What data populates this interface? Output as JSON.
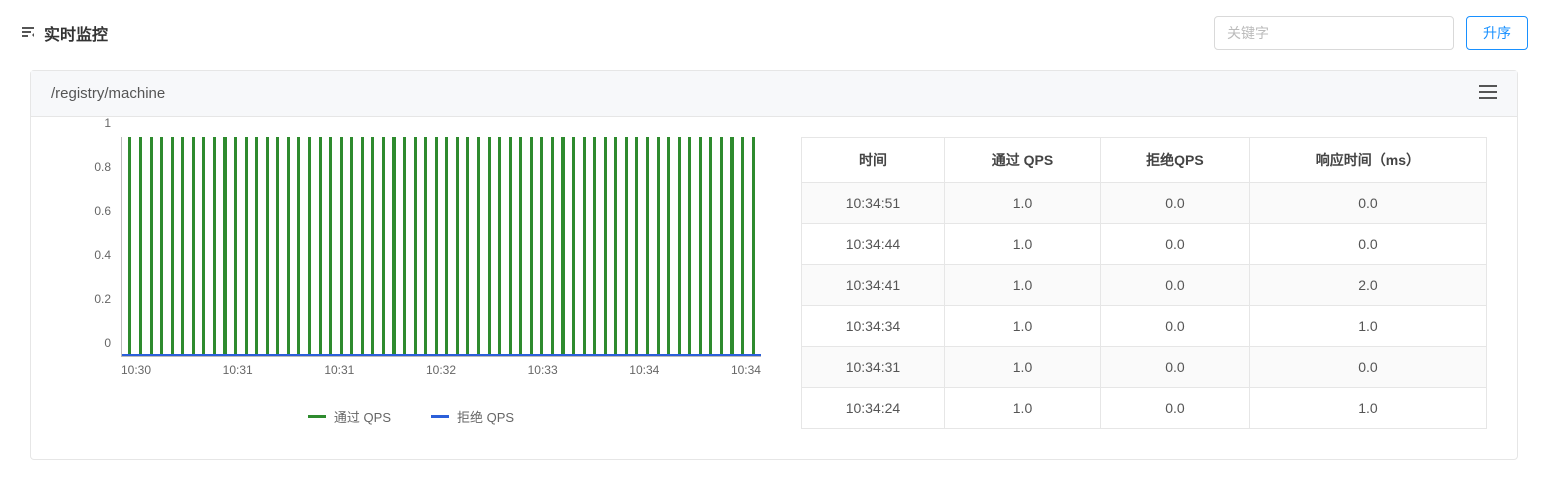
{
  "header": {
    "title": "实时监控",
    "keyword_placeholder": "关键字",
    "sort_button": "升序"
  },
  "panel": {
    "endpoint": "/registry/machine"
  },
  "chart_data": {
    "type": "bar",
    "title": "",
    "legend_position": "bottom",
    "ylim": [
      0,
      1
    ],
    "y_ticks": [
      "0",
      "0.2",
      "0.4",
      "0.6",
      "0.8",
      "1"
    ],
    "x_ticks": [
      "10:30",
      "10:31",
      "10:31",
      "10:32",
      "10:33",
      "10:34",
      "10:34"
    ],
    "series": [
      {
        "name": "通过 QPS",
        "color": "#2e8b2e",
        "values": [
          1,
          1,
          1,
          1,
          1,
          1,
          1,
          1,
          1,
          1,
          1,
          1,
          1,
          1,
          1,
          1,
          1,
          1,
          1,
          1,
          1,
          1,
          1,
          1,
          1,
          1,
          1,
          1,
          1,
          1,
          1,
          1,
          1,
          1,
          1,
          1,
          1,
          1,
          1,
          1,
          1,
          1,
          1,
          1,
          1,
          1,
          1,
          1,
          1,
          1,
          1,
          1,
          1,
          1,
          1,
          1,
          1,
          1,
          1,
          1
        ]
      },
      {
        "name": "拒绝 QPS",
        "color": "#2b5fd9",
        "values": [
          0,
          0,
          0,
          0,
          0,
          0,
          0,
          0,
          0,
          0,
          0,
          0,
          0,
          0,
          0,
          0,
          0,
          0,
          0,
          0,
          0,
          0,
          0,
          0,
          0,
          0,
          0,
          0,
          0,
          0,
          0,
          0,
          0,
          0,
          0,
          0,
          0,
          0,
          0,
          0,
          0,
          0,
          0,
          0,
          0,
          0,
          0,
          0,
          0,
          0,
          0,
          0,
          0,
          0,
          0,
          0,
          0,
          0,
          0,
          0
        ]
      }
    ]
  },
  "table": {
    "columns": [
      "时间",
      "通过 QPS",
      "拒绝QPS",
      "响应时间（ms）"
    ],
    "rows": [
      {
        "time": "10:34:51",
        "pass_qps": "1.0",
        "reject_qps": "0.0",
        "rt_ms": "0.0"
      },
      {
        "time": "10:34:44",
        "pass_qps": "1.0",
        "reject_qps": "0.0",
        "rt_ms": "0.0"
      },
      {
        "time": "10:34:41",
        "pass_qps": "1.0",
        "reject_qps": "0.0",
        "rt_ms": "2.0"
      },
      {
        "time": "10:34:34",
        "pass_qps": "1.0",
        "reject_qps": "0.0",
        "rt_ms": "1.0"
      },
      {
        "time": "10:34:31",
        "pass_qps": "1.0",
        "reject_qps": "0.0",
        "rt_ms": "0.0"
      },
      {
        "time": "10:34:24",
        "pass_qps": "1.0",
        "reject_qps": "0.0",
        "rt_ms": "1.0"
      }
    ]
  }
}
